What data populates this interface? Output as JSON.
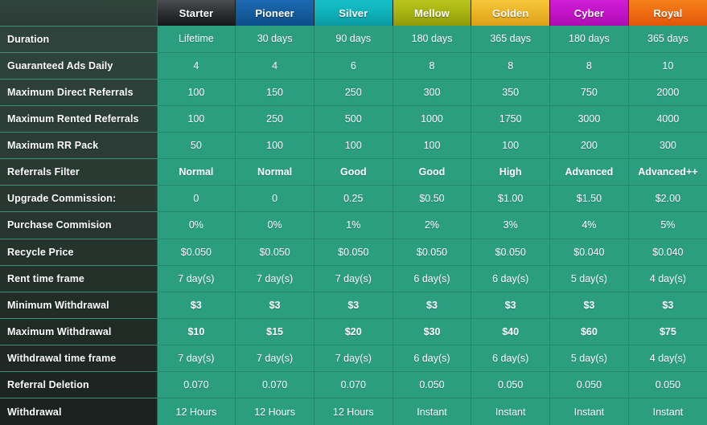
{
  "table": {
    "corner_label": "",
    "plans": [
      {
        "name": "Starter",
        "accent": "#2f3335"
      },
      {
        "name": "Pioneer",
        "accent": "#165d9f"
      },
      {
        "name": "Silver",
        "accent": "#10b2ba"
      },
      {
        "name": "Mellow",
        "accent": "#a8b412"
      },
      {
        "name": "Golden",
        "accent": "#ecb62a"
      },
      {
        "name": "Cyber",
        "accent": "#c314c9"
      },
      {
        "name": "Royal",
        "accent": "#ef6e12"
      }
    ],
    "rows": [
      {
        "label": "Duration",
        "bold": false,
        "values": [
          "Lifetime",
          "30 days",
          "90 days",
          "180 days",
          "365 days",
          "180 days",
          "365 days"
        ]
      },
      {
        "label": "Guaranteed Ads Daily",
        "bold": false,
        "values": [
          "4",
          "4",
          "6",
          "8",
          "8",
          "8",
          "10"
        ]
      },
      {
        "label": "Maximum Direct Referrals",
        "bold": false,
        "values": [
          "100",
          "150",
          "250",
          "300",
          "350",
          "750",
          "2000"
        ]
      },
      {
        "label": "Maximum Rented Referrals",
        "bold": false,
        "values": [
          "100",
          "250",
          "500",
          "1000",
          "1750",
          "3000",
          "4000"
        ]
      },
      {
        "label": "Maximum RR Pack",
        "bold": false,
        "values": [
          "50",
          "100",
          "100",
          "100",
          "100",
          "200",
          "300"
        ]
      },
      {
        "label": "Referrals Filter",
        "bold": true,
        "values": [
          "Normal",
          "Normal",
          "Good",
          "Good",
          "High",
          "Advanced",
          "Advanced++"
        ]
      },
      {
        "label": "Upgrade Commission:",
        "bold": false,
        "values": [
          "0",
          "0",
          "0.25",
          "$0.50",
          "$1.00",
          "$1.50",
          "$2.00"
        ]
      },
      {
        "label": "Purchase Commision",
        "bold": false,
        "values": [
          "0%",
          "0%",
          "1%",
          "2%",
          "3%",
          "4%",
          "5%"
        ]
      },
      {
        "label": "Recycle Price",
        "bold": false,
        "values": [
          "$0.050",
          "$0.050",
          "$0.050",
          "$0.050",
          "$0.050",
          "$0.040",
          "$0.040"
        ]
      },
      {
        "label": "Rent time frame",
        "bold": false,
        "values": [
          "7 day(s)",
          "7 day(s)",
          "7 day(s)",
          "6 day(s)",
          "6 day(s)",
          "5 day(s)",
          "4 day(s)"
        ]
      },
      {
        "label": "Minimum Withdrawal",
        "bold": true,
        "values": [
          "$3",
          "$3",
          "$3",
          "$3",
          "$3",
          "$3",
          "$3"
        ]
      },
      {
        "label": "Maximum Withdrawal",
        "bold": true,
        "values": [
          "$10",
          "$15",
          "$20",
          "$30",
          "$40",
          "$60",
          "$75"
        ]
      },
      {
        "label": "Withdrawal time frame",
        "bold": false,
        "values": [
          "7 day(s)",
          "7 day(s)",
          "7 day(s)",
          "6 day(s)",
          "6 day(s)",
          "5 day(s)",
          "4 day(s)"
        ]
      },
      {
        "label": "Referral Deletion",
        "bold": false,
        "values": [
          "0.070",
          "0.070",
          "0.070",
          "0.050",
          "0.050",
          "0.050",
          "0.050"
        ]
      },
      {
        "label": "Withdrawal",
        "bold": false,
        "values": [
          "12 Hours",
          "12 Hours",
          "12 Hours",
          "Instant",
          "Instant",
          "Instant",
          "Instant"
        ]
      }
    ]
  },
  "theme": {
    "data_cell_bg": "#2b9e80",
    "label_col_top": "#2e433c",
    "label_col_bottom": "#1b2220",
    "cell_border": "#25876e",
    "text_color": "#ffffff"
  }
}
